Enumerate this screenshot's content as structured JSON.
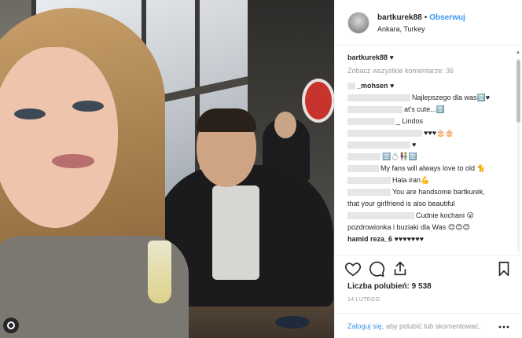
{
  "header": {
    "username": "bartkurek88",
    "separator": "•",
    "follow_label": "Obserwuj",
    "location": "Ankara, Turkey"
  },
  "caption": {
    "username": "bartkurek88",
    "text": "♥"
  },
  "view_all_label": "Zobacz wszystkie komentarze: 36",
  "comments": [
    {
      "name": "_mohsen",
      "text": "♥",
      "blur": 10
    },
    {
      "name": "",
      "text": "Najlepszego dla was🈳♥",
      "blur": 80
    },
    {
      "name": "",
      "text": "at's cute...🈳",
      "blur": 70
    },
    {
      "name": "",
      "text": "_ Lindos",
      "blur": 60
    },
    {
      "name": "",
      "text": "♥♥♥🎂🎂",
      "blur": 95
    },
    {
      "name": "",
      "text": "♥",
      "blur": 80
    },
    {
      "name": "",
      "text": "🈳💍👫🈳",
      "blur": 42
    },
    {
      "name": "",
      "text": "My fans will always love to old 🐈",
      "blur": 40
    },
    {
      "name": "",
      "text": "Hala iran💪",
      "blur": 55
    },
    {
      "name": "",
      "text": "You are handsome bartkurek,",
      "blur": 55
    },
    {
      "name": "",
      "text": "that your girlfriend is also beautiful",
      "blur": 0
    },
    {
      "name": "",
      "text": "Cudnie kochani 😮",
      "blur": 85
    },
    {
      "name": "",
      "text": "pozdrowionka i buziaki dla Was 😊😊😊",
      "blur": 0
    },
    {
      "name": "hamid reza_6",
      "text": "♥♥♥♥♥♥♥",
      "blur": 0
    }
  ],
  "likes_label": "Liczba polubień: 9 538",
  "date_label": "14 LUTEGO",
  "login": {
    "link": "Zaloguj się,",
    "rest": "aby polubić lub skomentować."
  },
  "icons": [
    "heart-icon",
    "comment-icon",
    "share-icon",
    "bookmark-icon",
    "more-icon"
  ],
  "colors": {
    "link": "#3897f0",
    "muted": "#999999",
    "text": "#262626"
  }
}
